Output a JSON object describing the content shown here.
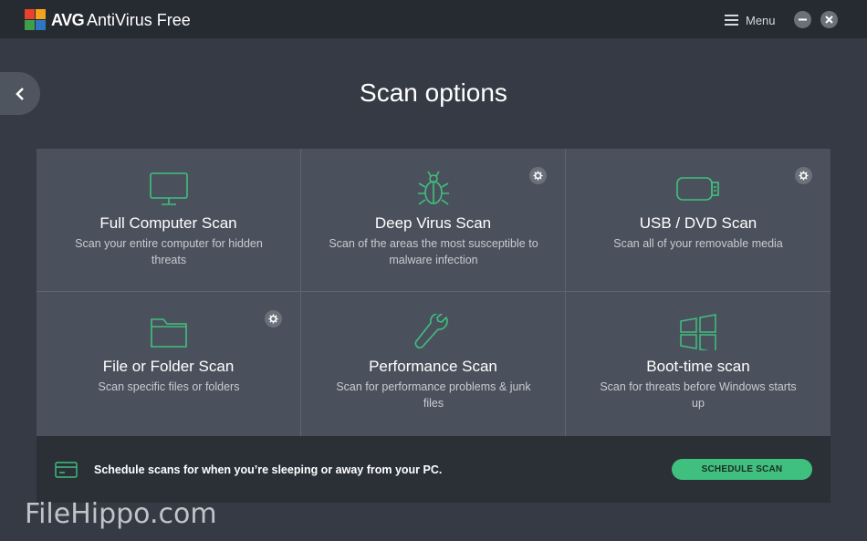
{
  "titlebar": {
    "brand": "AVG",
    "product": "AntiVirus Free",
    "menu_label": "Menu"
  },
  "page": {
    "title": "Scan options"
  },
  "tiles": [
    {
      "title": "Full Computer Scan",
      "desc": "Scan your entire computer for hidden threats",
      "icon": "monitor-icon",
      "settings": false
    },
    {
      "title": "Deep Virus Scan",
      "desc": "Scan of the areas the most susceptible to malware infection",
      "icon": "bug-icon",
      "settings": true
    },
    {
      "title": "USB / DVD Scan",
      "desc": "Scan all of your removable media",
      "icon": "usb-icon",
      "settings": true
    },
    {
      "title": "File or Folder Scan",
      "desc": "Scan specific files or folders",
      "icon": "folder-icon",
      "settings": true
    },
    {
      "title": "Performance Scan",
      "desc": "Scan for performance problems & junk files",
      "icon": "wrench-icon",
      "settings": false
    },
    {
      "title": "Boot-time scan",
      "desc": "Scan for threats before Windows starts up",
      "icon": "windows-icon",
      "settings": false
    }
  ],
  "schedule": {
    "text": "Schedule scans for when you’re sleeping or away from your PC.",
    "button": "SCHEDULE SCAN"
  },
  "watermark": "FileHippo.com",
  "colors": {
    "accent": "#3fc07f",
    "icon_stroke": "#3fc07f",
    "tile_bg": "#4b515c"
  }
}
